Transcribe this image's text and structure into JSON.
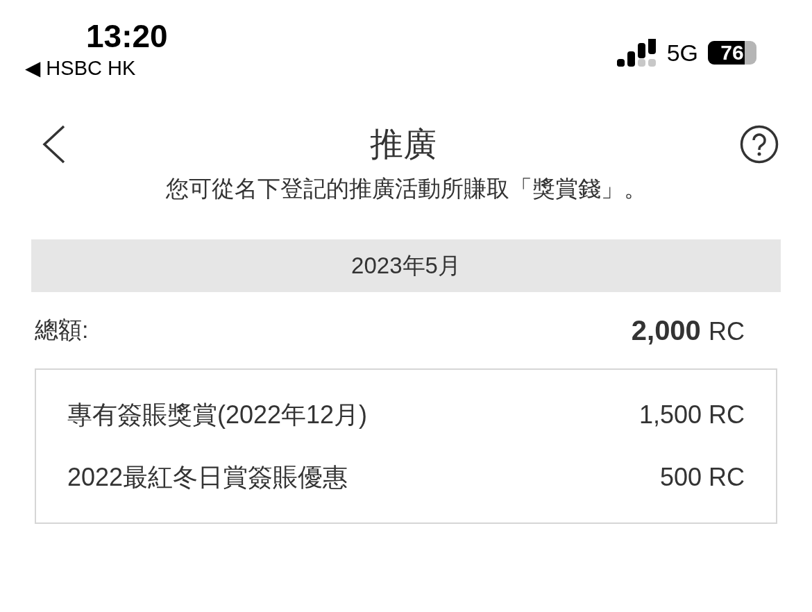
{
  "status_bar": {
    "time": "13:20",
    "back_app": "◀ HSBC HK",
    "network": "5G",
    "battery": "76"
  },
  "nav": {
    "title": "推廣"
  },
  "intro": "您可從名下登記的推廣活動所賺取「獎賞錢」。",
  "month": "2023年5月",
  "total": {
    "label": "總額:",
    "amount": "2,000",
    "unit": "RC"
  },
  "items": [
    {
      "name": "專有簽賬獎賞(2022年12月)",
      "amount": "1,500 RC"
    },
    {
      "name": "2022最紅冬日賞簽賬優惠",
      "amount": "500 RC"
    }
  ]
}
